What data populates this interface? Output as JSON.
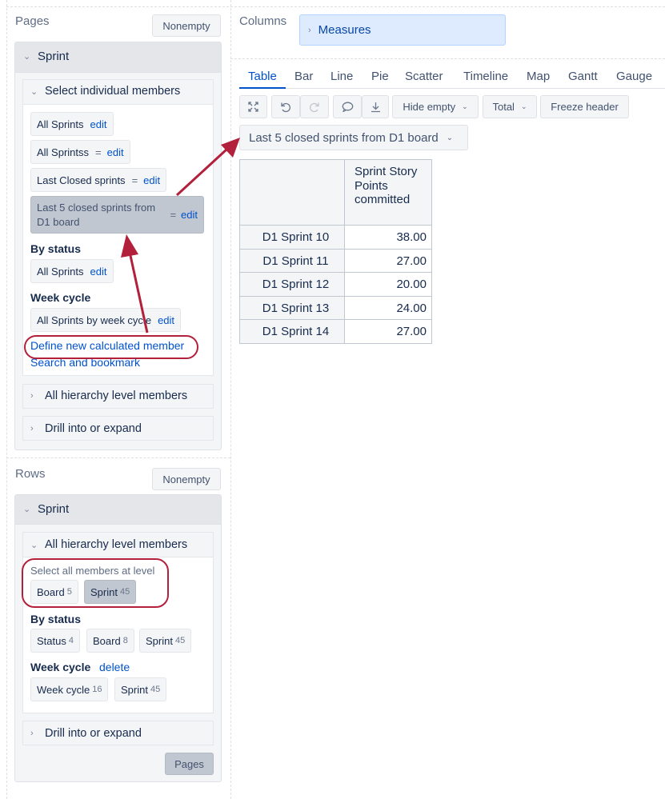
{
  "left": {
    "pages": {
      "title": "Pages",
      "nonempty_label": "Nonempty",
      "dimension": "Sprint",
      "select_individual": "Select individual members",
      "members": [
        {
          "label": "All Sprints",
          "eq": "",
          "edit": "edit"
        },
        {
          "label": "All Sprintss",
          "eq": "=",
          "edit": "edit"
        },
        {
          "label": "Last Closed sprints",
          "eq": "=",
          "edit": "edit"
        },
        {
          "label": "Last 5 closed sprints from D1 board",
          "eq": "=",
          "edit": "edit"
        }
      ],
      "by_status": "By status",
      "by_status_member": {
        "label": "All Sprints",
        "edit": "edit"
      },
      "week_cycle": "Week cycle",
      "week_cycle_member": {
        "label": "All Sprints by week cycle",
        "edit": "edit"
      },
      "define_link": "Define new calculated member",
      "search_link": "Search and bookmark",
      "all_hierarchy": "All hierarchy level members",
      "drill": "Drill into or expand"
    },
    "rows": {
      "title": "Rows",
      "nonempty_label": "Nonempty",
      "dimension": "Sprint",
      "all_hierarchy": "All hierarchy level members",
      "select_all_at_level": "Select all members at level",
      "levels": [
        {
          "label": "Board",
          "count": "5"
        },
        {
          "label": "Sprint",
          "count": "45"
        }
      ],
      "by_status": "By status",
      "status_levels": [
        {
          "label": "Status",
          "count": "4"
        },
        {
          "label": "Board",
          "count": "8"
        },
        {
          "label": "Sprint",
          "count": "45"
        }
      ],
      "week_cycle": "Week cycle",
      "delete_label": "delete",
      "week_levels": [
        {
          "label": "Week cycle",
          "count": "16"
        },
        {
          "label": "Sprint",
          "count": "45"
        }
      ],
      "drill": "Drill into or expand",
      "pages_button": "Pages"
    }
  },
  "columns": {
    "title": "Columns",
    "measures": "Measures"
  },
  "tabs": [
    "Table",
    "Bar",
    "Line",
    "Pie",
    "Scatter",
    "Timeline",
    "Map",
    "Gantt",
    "Gauge"
  ],
  "active_tab": "Table",
  "toolbar": {
    "hide_empty": "Hide empty",
    "total": "Total",
    "freeze_header": "Freeze header"
  },
  "page_filter": "Last 5 closed sprints from D1 board",
  "table": {
    "header": "Sprint Story Points committed",
    "rows": [
      {
        "name": "D1 Sprint 10",
        "value": "38.00"
      },
      {
        "name": "D1 Sprint 11",
        "value": "27.00"
      },
      {
        "name": "D1 Sprint 12",
        "value": "20.00"
      },
      {
        "name": "D1 Sprint 13",
        "value": "24.00"
      },
      {
        "name": "D1 Sprint 14",
        "value": "27.00"
      }
    ]
  },
  "colors": {
    "link": "#0052cc",
    "annotation": "#b3203b",
    "selected_chip": "#c1c7d0",
    "measures_bg": "#deebff"
  }
}
